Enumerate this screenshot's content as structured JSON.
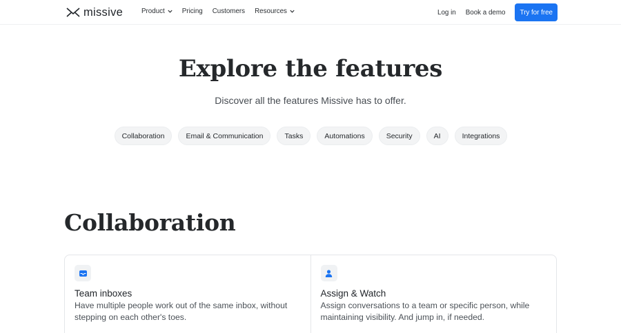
{
  "nav": {
    "brand": "missive",
    "links": [
      {
        "label": "Product",
        "has_dropdown": true
      },
      {
        "label": "Pricing",
        "has_dropdown": false
      },
      {
        "label": "Customers",
        "has_dropdown": false
      },
      {
        "label": "Resources",
        "has_dropdown": true
      }
    ],
    "login": "Log in",
    "demo": "Book a demo",
    "cta": "Try for free"
  },
  "hero": {
    "title": "Explore the features",
    "subtitle": "Discover all the features Missive has to offer."
  },
  "chips": [
    "Collaboration",
    "Email & Communication",
    "Tasks",
    "Automations",
    "Security",
    "AI",
    "Integrations"
  ],
  "section": {
    "title": "Collaboration",
    "cards": [
      {
        "icon": "inbox-tray-icon",
        "title": "Team inboxes",
        "description": "Have multiple people work out of the same inbox, without stepping on each other's toes."
      },
      {
        "icon": "person-icon",
        "title": "Assign & Watch",
        "description": "Assign conversations to a team or specific person, while maintaining visibility. And jump in, if needed."
      }
    ]
  },
  "colors": {
    "accent": "#1b74f2",
    "icon": "#1b74f2",
    "chip_bg": "#f3f4f5"
  }
}
